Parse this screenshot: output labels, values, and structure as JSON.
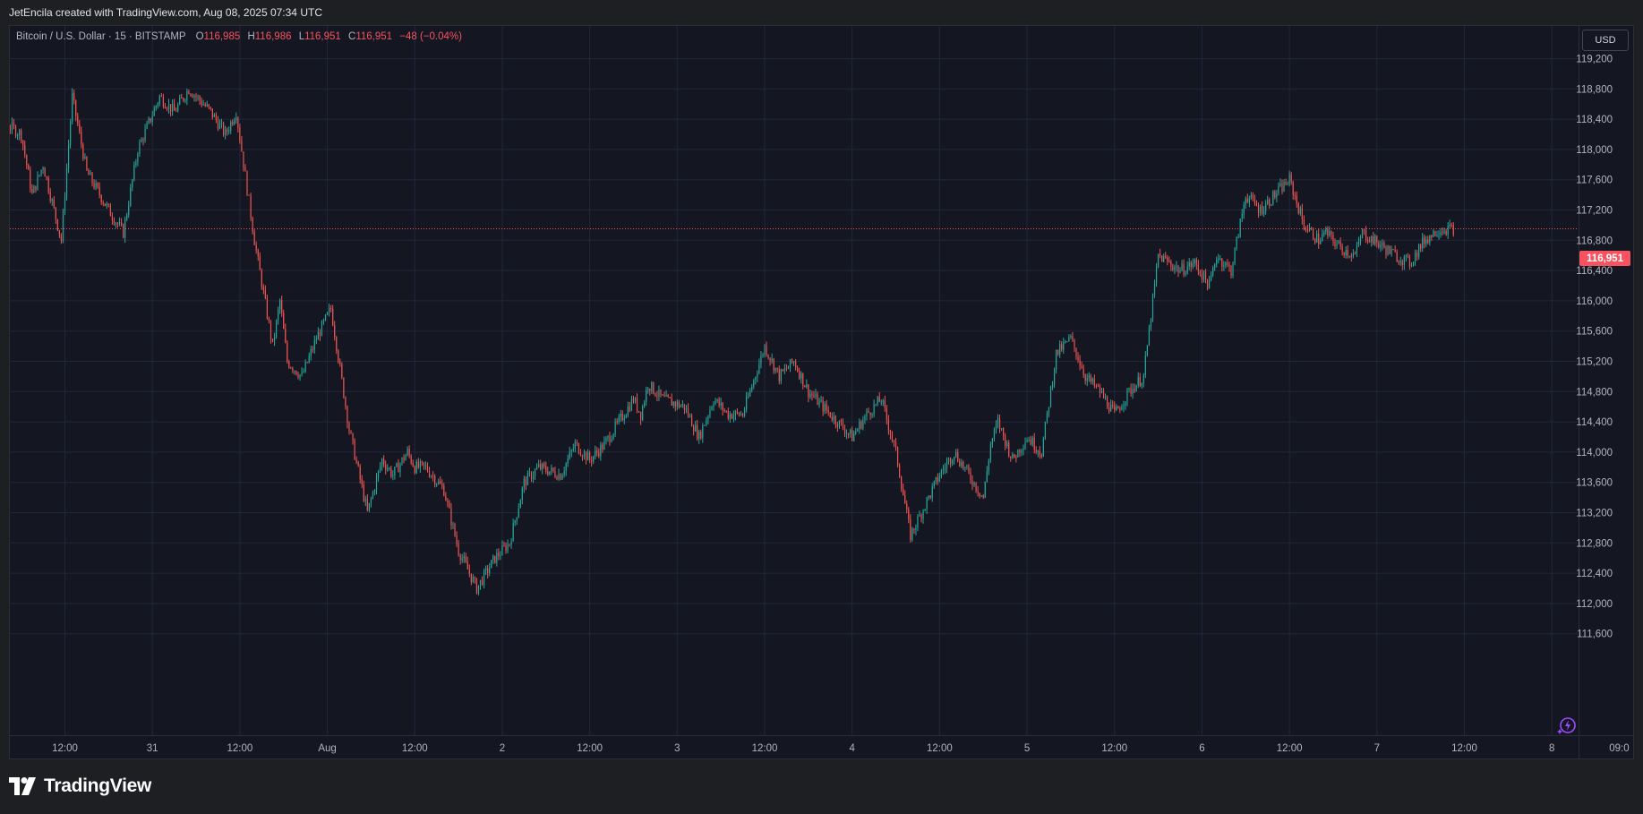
{
  "header": {
    "credit": "JetEncila created with TradingView.com, Aug 08, 2025 07:34 UTC"
  },
  "legend": {
    "symbol": "Bitcoin / U.S. Dollar · 15 · BITSTAMP",
    "open_label": "O",
    "open": "116,985",
    "high_label": "H",
    "high": "116,986",
    "low_label": "L",
    "low": "116,951",
    "close_label": "C",
    "close": "116,951",
    "change": "−48 (−0.04%)"
  },
  "currency_button": "USD",
  "last_price_label": "116,951",
  "brand": {
    "name": "TradingView"
  },
  "colors": {
    "up": "#26a69a",
    "down": "#ef5350",
    "background": "#141722",
    "grid": "#22263a",
    "price_line": "#f7525f"
  },
  "chart_data": {
    "type": "line",
    "style": "candlestick (15-minute bars)",
    "instrument": "BTC/USD",
    "x_ticks": [
      "12:00",
      "31",
      "12:00",
      "Aug",
      "12:00",
      "2",
      "12:00",
      "3",
      "12:00",
      "4",
      "12:00",
      "5",
      "12:00",
      "6",
      "12:00",
      "7",
      "12:00",
      "8",
      "09:0"
    ],
    "y_ticks": [
      "119,200",
      "118,800",
      "118,400",
      "118,000",
      "117,600",
      "117,200",
      "116,800",
      "116,400",
      "116,000",
      "115,600",
      "115,200",
      "114,800",
      "114,400",
      "114,000",
      "113,600",
      "113,200",
      "112,800",
      "112,400",
      "112,000",
      "111,600"
    ],
    "ylim": [
      111300,
      119500
    ],
    "grid": true,
    "last_price": 116951,
    "x": [
      -13.5,
      -11,
      -9,
      -6,
      -4.5,
      -3,
      -0.5,
      1,
      3,
      6,
      8,
      10,
      13,
      15,
      17,
      20,
      22,
      23.5,
      26,
      28.5,
      29.5,
      30.5,
      32.5,
      34.5,
      36.5,
      39,
      41.5,
      43.5,
      45,
      47,
      48,
      49.5,
      52,
      54,
      56.5,
      59,
      61,
      63,
      65,
      68,
      70,
      72,
      74,
      76,
      78,
      79,
      80,
      82,
      85,
      87,
      89,
      91,
      93,
      96,
      98,
      100,
      102,
      104,
      106,
      108,
      110,
      112,
      114,
      116,
      118,
      120,
      122,
      124,
      126,
      127,
      128,
      130,
      132,
      134,
      136,
      138,
      140,
      142,
      144,
      146,
      148,
      150,
      153,
      155,
      157,
      158,
      160,
      162,
      164,
      166,
      168,
      170,
      172,
      173,
      175,
      177,
      178,
      179.5,
      181,
      182.5,
      184.5,
      186.5,
      188.5,
      190.5,
      192,
      193.3
    ],
    "series": [
      {
        "values": [
          118100,
          118300,
          118400,
          118200,
          117400,
          117800,
          116800,
          118700,
          117700,
          117200,
          116900,
          118000,
          118700,
          118500,
          118800,
          118500,
          118200,
          118500,
          116800,
          115400,
          116000,
          115200,
          115000,
          115500,
          115900,
          114300,
          113200,
          113900,
          113700,
          114000,
          113800,
          113800,
          113500,
          112700,
          112200,
          112600,
          112800,
          113600,
          113800,
          113700,
          114100,
          113900,
          114100,
          114400,
          114700,
          114500,
          114900,
          114700,
          114600,
          114200,
          114700,
          114500,
          114500,
          115400,
          115000,
          115200,
          114800,
          114600,
          114400,
          114200,
          114500,
          114700,
          114000,
          112900,
          113300,
          113700,
          114000,
          113700,
          113400,
          114100,
          114400,
          113900,
          114200,
          114000,
          115300,
          115500,
          115000,
          114800,
          114500,
          114800,
          115000,
          116600,
          116400,
          116500,
          116200,
          116600,
          116400,
          117400,
          117200,
          117400,
          117600,
          117000,
          116800,
          116900,
          116700,
          116600,
          116900,
          116800,
          116700,
          116600,
          116500,
          116800,
          116951,
          116951
        ]
      }
    ]
  }
}
